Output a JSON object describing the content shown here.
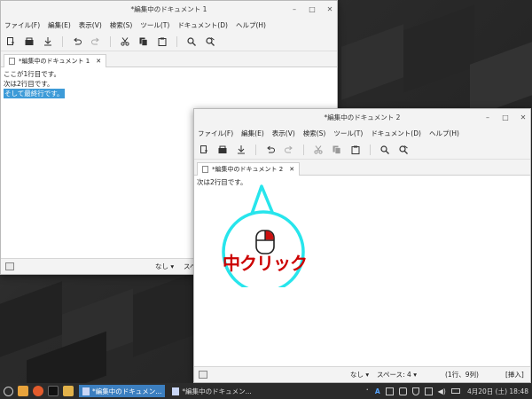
{
  "menu": [
    "ファイル(F)",
    "編集(E)",
    "表示(V)",
    "検索(S)",
    "ツール(T)",
    "ドキュメント(D)",
    "ヘルプ(H)"
  ],
  "window1": {
    "title": "*編集中のドキュメント 1",
    "tab_label": "*編集中のドキュメント 1",
    "lines": [
      "ここが1行目です。",
      "次は2行目です。",
      "そして最終行です。"
    ],
    "status_highlight": "なし",
    "status_spaces": "スペ"
  },
  "window2": {
    "title": "*編集中のドキュメント 2",
    "tab_label": "*編集中のドキュメント 2",
    "lines": [
      "次は2行目です。"
    ],
    "status_highlight": "なし",
    "status_spaces": "スペース: 4",
    "status_position": "(1行、9列)",
    "status_mode": "[挿入]"
  },
  "annotation": {
    "text": "中クリック"
  },
  "taskbar": {
    "items": [
      "*編集中のドキュメン...",
      "*編集中のドキュメン..."
    ],
    "ime": "A",
    "clock": "4月20日 (土) 18:48"
  },
  "colors": {
    "accent": "#3d9bd8",
    "annotation_text": "#cc0000",
    "bubble": "#27e5ec"
  },
  "icons": [
    "new-document-icon",
    "open-icon",
    "save-icon",
    "undo-icon",
    "redo-icon",
    "cut-icon",
    "copy-icon",
    "paste-icon",
    "search-icon",
    "replace-icon"
  ]
}
